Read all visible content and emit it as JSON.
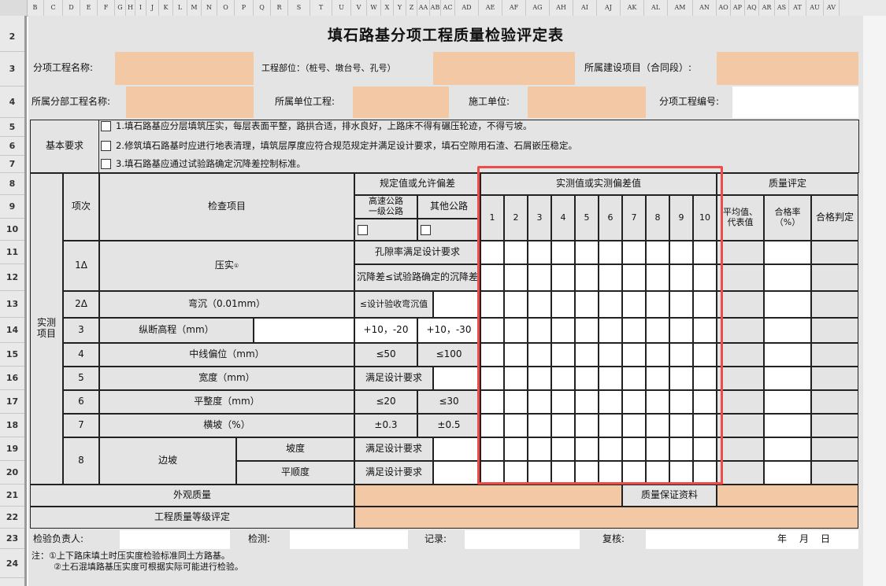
{
  "sheet": {
    "column_headers": [
      "B",
      "C",
      "D",
      "E",
      "F",
      "G",
      "H",
      "I",
      "J",
      "K",
      "L",
      "M",
      "N",
      "O",
      "P",
      "Q",
      "R",
      "S",
      "T",
      "U",
      "V",
      "W",
      "X",
      "Y",
      "Z",
      "AA",
      "AB",
      "AC",
      "AD",
      "AE",
      "AF",
      "AG",
      "AH",
      "AI",
      "AJ",
      "AK",
      "AL",
      "AM",
      "AN",
      "AO",
      "AP",
      "AQ",
      "AR",
      "AS",
      "AT",
      "AU",
      "AV"
    ],
    "row_headers": [
      "2",
      "3",
      "4",
      "5",
      "6",
      "7",
      "8",
      "9",
      "10",
      "11",
      "12",
      "13",
      "14",
      "15",
      "16",
      "17",
      "18",
      "19",
      "20",
      "21",
      "22",
      "23",
      "24"
    ]
  },
  "form": {
    "title": "填石路基分项工程质量检验评定表",
    "subitem_name_label": "分项工程名称:",
    "location_label": "工程部位：（桩号、墩台号、孔号）",
    "project_label": "所属建设项目（合同段）:",
    "division_label": "所属分部工程名称:",
    "unit_project_label": "所属单位工程:",
    "construction_unit_label": "施工单位:",
    "subitem_no_label": "分项工程编号:"
  },
  "basic": {
    "label": "基本要求",
    "items": [
      "1.填石路基应分层填筑压实，每层表面平整，路拱合适，排水良好，上路床不得有碾压轮迹，不得亏坡。",
      "2.修筑填石路基时应进行地表清理，填筑层厚度应符合规范规定并满足设计要求，填石空隙用石渣、石屑嵌压稳定。",
      "3.填石路基应通过试验路确定沉降差控制标准。"
    ]
  },
  "headers": {
    "spec": "规定值或允许偏差",
    "measured": "实测值或实测偏差值",
    "quality": "质量评定",
    "item_no": "项次",
    "check_item": "检查项目",
    "highway": "高速公路\n一级公路",
    "other_road": "其他公路",
    "numbers": [
      "1",
      "2",
      "3",
      "4",
      "5",
      "6",
      "7",
      "8",
      "9",
      "10"
    ],
    "avg": "平均值、\n代表值",
    "pass_rate": "合格率\n（%）",
    "judge": "合格判定",
    "measured_items": "实测\n项目"
  },
  "rows": [
    {
      "no": "1Δ",
      "name": "压实",
      "sup": "①",
      "spec_a": "孔隙率满足设计要求",
      "spec_b": "沉降差≤试验路确定的沉降差"
    },
    {
      "no": "2Δ",
      "name": "弯沉（0.01mm）",
      "spec": "≤设计验收弯沉值"
    },
    {
      "no": "3",
      "name": "纵断高程（mm）",
      "spec_high": "+10，-20",
      "spec_other": "+10，-30"
    },
    {
      "no": "4",
      "name": "中线偏位（mm）",
      "spec_high": "≤50",
      "spec_other": "≤100"
    },
    {
      "no": "5",
      "name": "宽度（mm）",
      "spec": "满足设计要求"
    },
    {
      "no": "6",
      "name": "平整度（mm）",
      "spec_high": "≤20",
      "spec_other": "≤30"
    },
    {
      "no": "7",
      "name": "横坡（%）",
      "spec_high": "±0.3",
      "spec_other": "±0.5"
    },
    {
      "no": "8",
      "name": "边坡",
      "sub": [
        "坡度",
        "平顺度"
      ],
      "spec": "满足设计要求"
    }
  ],
  "bottom": {
    "appearance": "外观质量",
    "quality_docs": "质量保证资料",
    "grade": "工程质量等级评定",
    "inspector": "检验负责人:",
    "checker": "检测:",
    "recorder": "记录:",
    "reviewer": "复核:",
    "date_year": "年",
    "date_month": "月",
    "date_day": "日",
    "note1": "注：①上下路床填土时压实度检验标准同土方路基。",
    "note2": "②土石混填路基压实度可根据实际可能进行检验。"
  },
  "colors": {
    "fill_orange": "#f2c9a4",
    "highlight": "#ee4b4b",
    "sheet_gray": "#e4e4e4"
  }
}
